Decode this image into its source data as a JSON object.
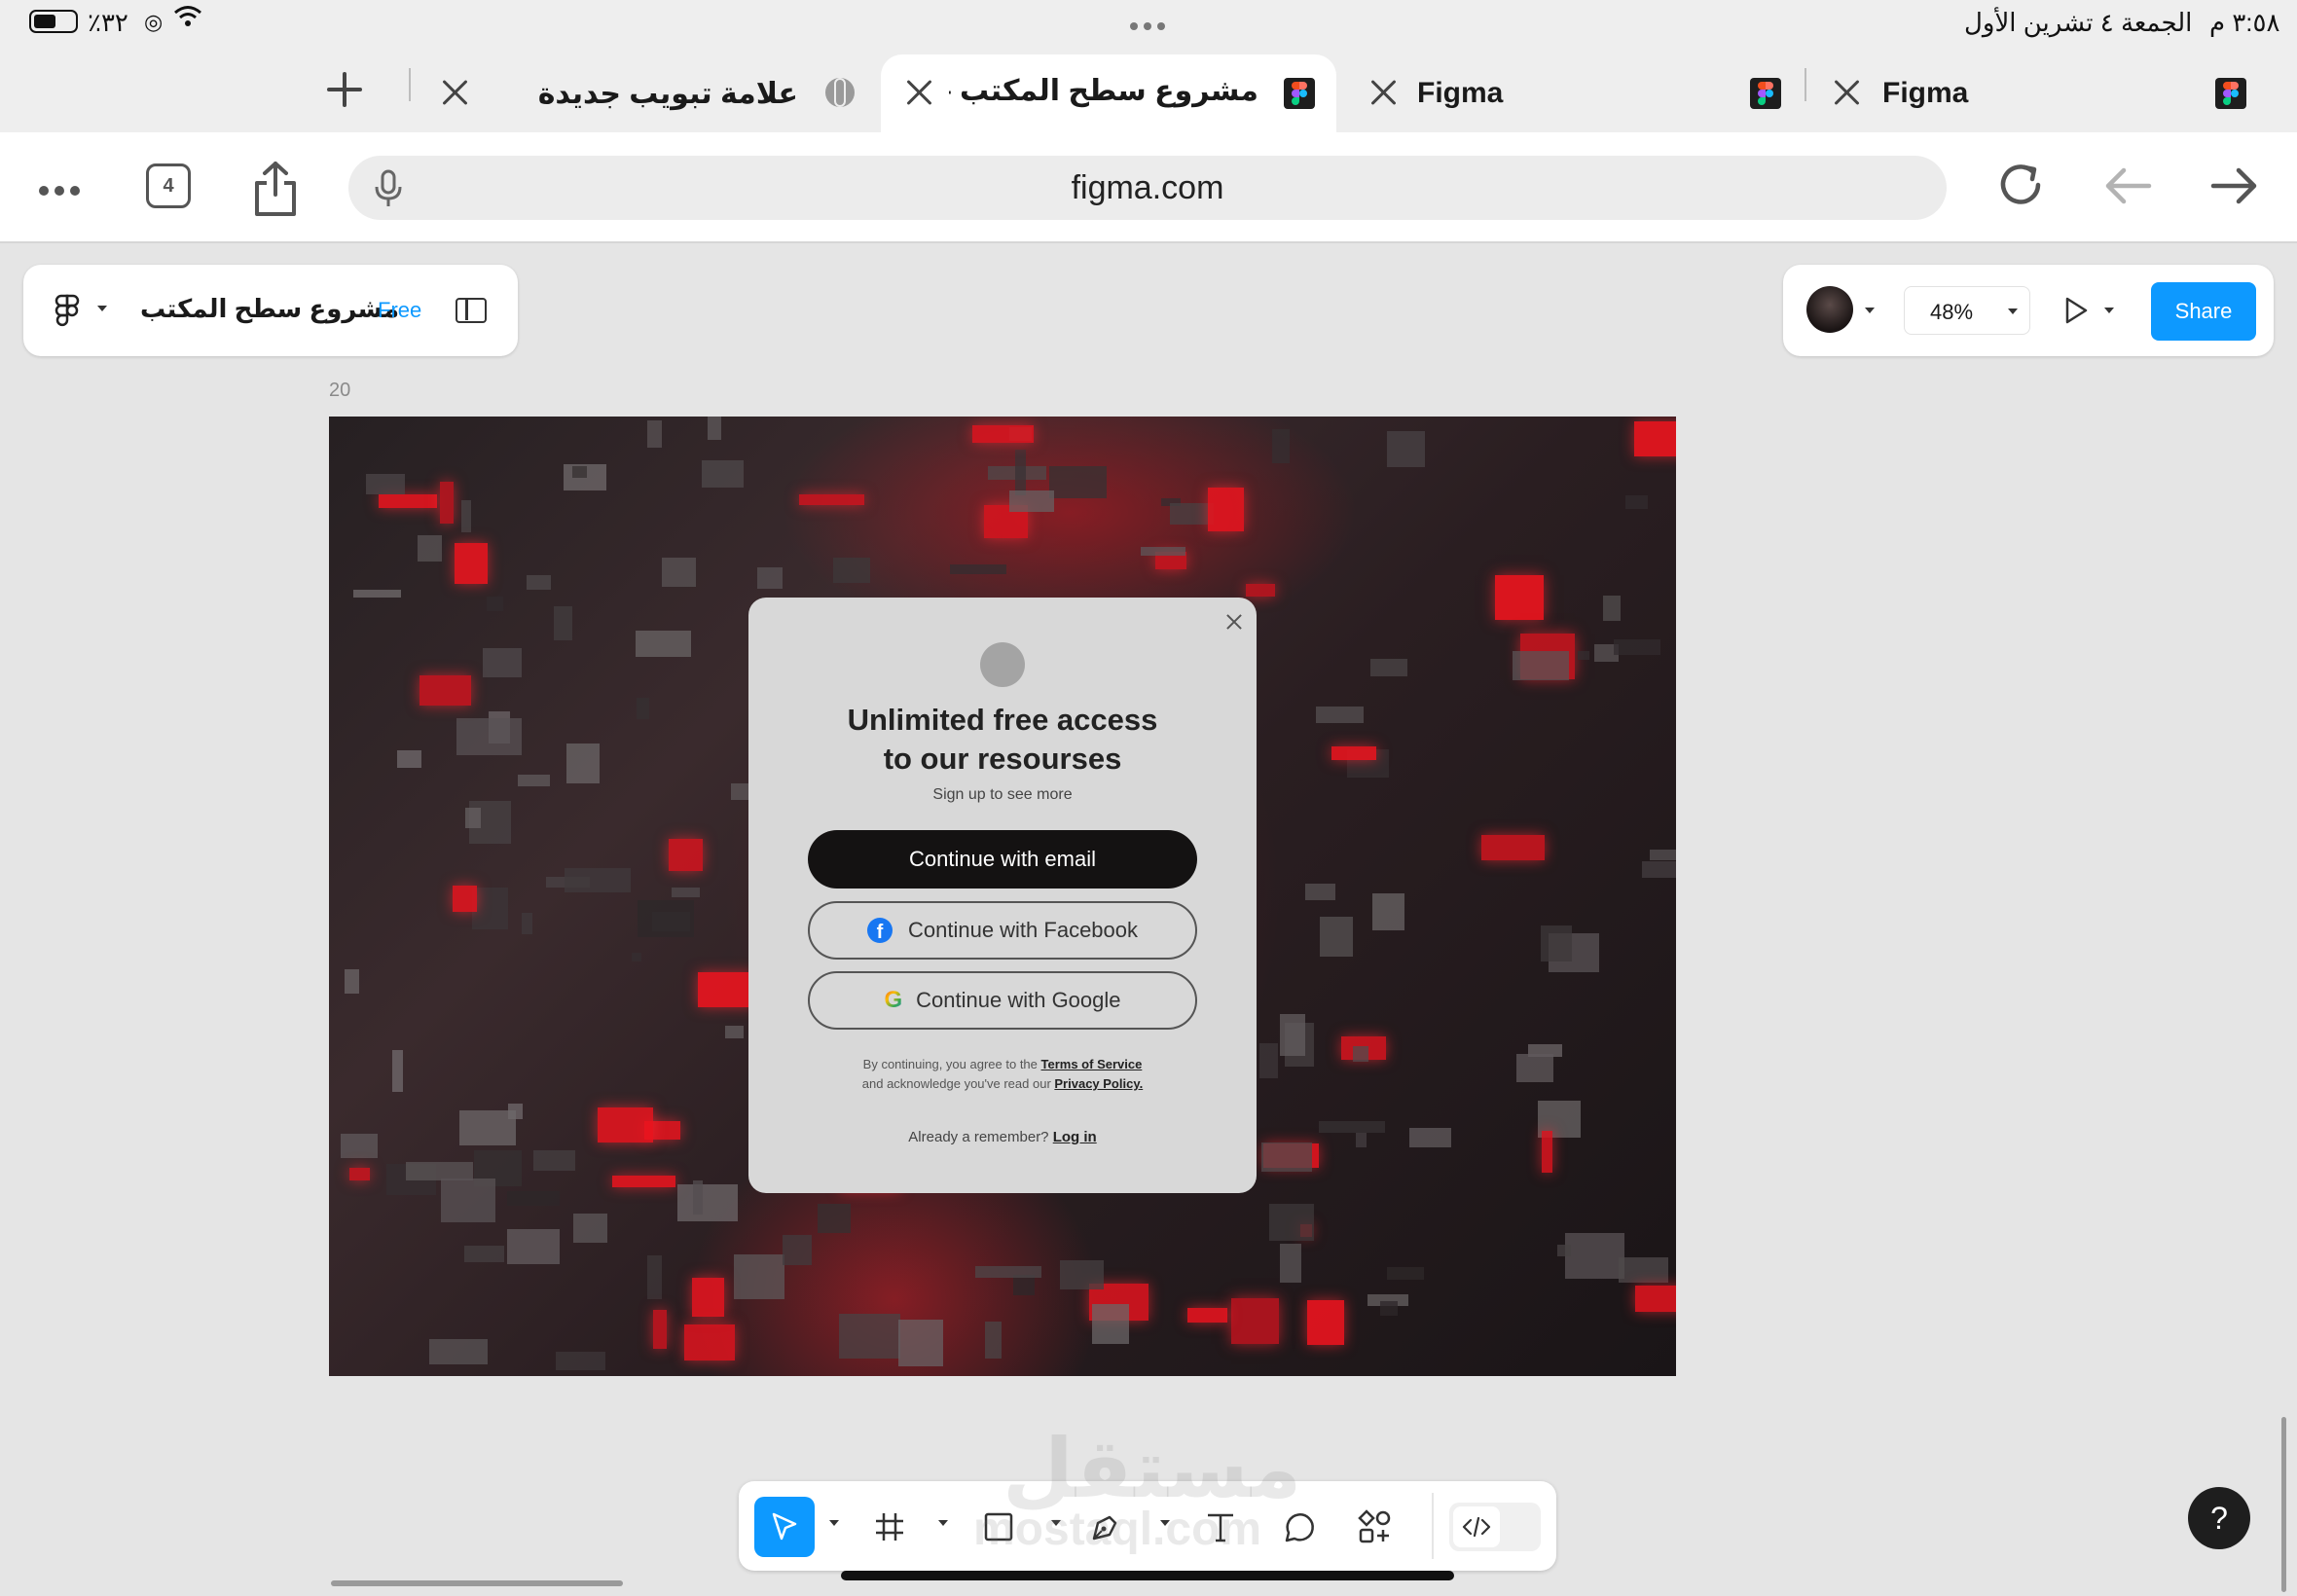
{
  "status_bar": {
    "time": "٣:٥٨ م",
    "date": "الجمعة ٤ تشرين الأول",
    "battery": "٪٣٢"
  },
  "tabs": [
    {
      "label": "Figma",
      "active": false
    },
    {
      "label": "Figma",
      "active": false
    },
    {
      "label": "مشروع سطح المكتب – Figma",
      "active": true
    },
    {
      "label": "علامة تبويب جديدة",
      "active": false
    }
  ],
  "browser": {
    "url": "figma.com",
    "tab_count": "4"
  },
  "figma_header": {
    "file_name": "مشروع سطح المكتب",
    "plan_badge": "Free",
    "zoom": "48%",
    "share_label": "Share"
  },
  "canvas": {
    "frame_label": "20"
  },
  "modal": {
    "title_line1": "Unlimited free access",
    "title_line2": "to our resourses",
    "subtitle": "Sign up to see more",
    "email_button": "Continue with email",
    "facebook_button": "Continue with Facebook",
    "google_button": "Continue with Google",
    "terms_line1_prefix": "By continuing, you agree to the ",
    "terms_link": "Terms of Service",
    "terms_line2_prefix": "and acknowledge you've read our ",
    "privacy_link": "Privacy Policy.",
    "already_prefix": "Already a remember? ",
    "login_link": "Log in"
  },
  "help": {
    "label": "?"
  },
  "watermark": {
    "arabic": "مستقل",
    "latin": "mostaql.com"
  },
  "colors": {
    "share_blue": "#0d99ff",
    "badge_blue": "#0d99ff",
    "modal_bg": "#d8d8d8",
    "email_btn_bg": "#141212"
  }
}
